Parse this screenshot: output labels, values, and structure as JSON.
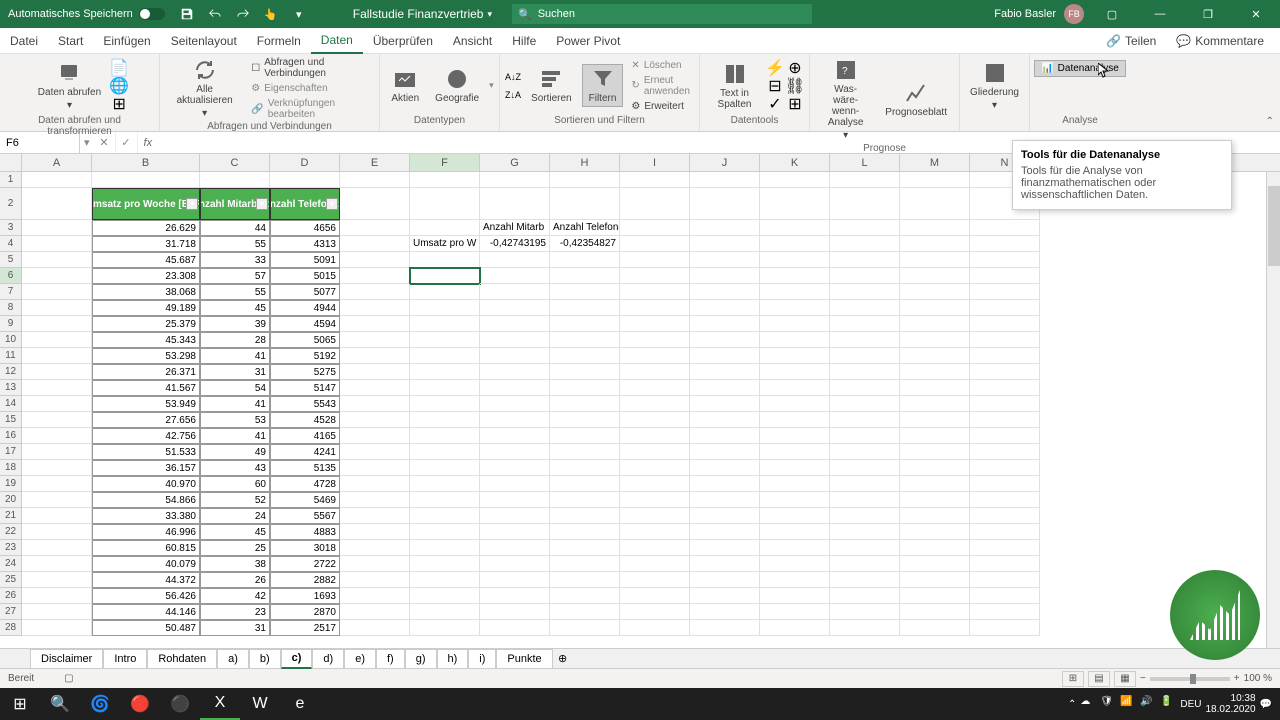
{
  "titlebar": {
    "autosave": "Automatisches Speichern",
    "filename": "Fallstudie Finanzvertrieb",
    "search_placeholder": "Suchen",
    "user": "Fabio Basler",
    "user_initials": "FB"
  },
  "menubar": {
    "items": [
      "Datei",
      "Start",
      "Einfügen",
      "Seitenlayout",
      "Formeln",
      "Daten",
      "Überprüfen",
      "Ansicht",
      "Hilfe",
      "Power Pivot"
    ],
    "active_index": 5,
    "share": "Teilen",
    "comments": "Kommentare"
  },
  "ribbon": {
    "groups": {
      "abrufen": {
        "label": "Daten abrufen und transformieren",
        "daten_abrufen": "Daten abrufen"
      },
      "abfragen": {
        "label": "Abfragen und Verbindungen",
        "alle_aktualisieren": "Alle aktualisieren",
        "abfragen": "Abfragen und Verbindungen",
        "eigenschaften": "Eigenschaften",
        "verknuepfungen": "Verknüpfungen bearbeiten"
      },
      "datentypen": {
        "label": "Datentypen",
        "aktien": "Aktien",
        "geografie": "Geografie"
      },
      "sortieren": {
        "label": "Sortieren und Filtern",
        "sortieren": "Sortieren",
        "filtern": "Filtern",
        "loeschen": "Löschen",
        "erneut": "Erneut anwenden",
        "erweitert": "Erweitert"
      },
      "datentools": {
        "label": "Datentools",
        "text_spalten": "Text in Spalten"
      },
      "prognose": {
        "label": "Prognose",
        "was_waere": "Was-wäre-wenn-Analyse",
        "prognoseblatt": "Prognoseblatt"
      },
      "gliederung": {
        "label": "",
        "gliederung": "Gliederung"
      },
      "analyse": {
        "label": "Analyse",
        "datenanalyse": "Datenanalyse"
      }
    }
  },
  "tooltip": {
    "title": "Tools für die Datenanalyse",
    "body": "Tools für die Analyse von finanzmathematischen oder wissenschaftlichen Daten."
  },
  "formula_bar": {
    "name_box": "F6",
    "formula": ""
  },
  "columns": [
    "A",
    "B",
    "C",
    "D",
    "E",
    "F",
    "G",
    "H",
    "I",
    "J",
    "K",
    "L",
    "M",
    "N"
  ],
  "selected_col": "F",
  "selected_row": 6,
  "table": {
    "headers": {
      "b": "Umsatz pro Woche [EUR]",
      "c": "Anzahl Mitarbeiter",
      "d": "Anzahl Telefonate"
    },
    "rows": [
      {
        "b": "26.629",
        "c": "44",
        "d": "4656"
      },
      {
        "b": "31.718",
        "c": "55",
        "d": "4313"
      },
      {
        "b": "45.687",
        "c": "33",
        "d": "5091"
      },
      {
        "b": "23.308",
        "c": "57",
        "d": "5015"
      },
      {
        "b": "38.068",
        "c": "55",
        "d": "5077"
      },
      {
        "b": "49.189",
        "c": "45",
        "d": "4944"
      },
      {
        "b": "25.379",
        "c": "39",
        "d": "4594"
      },
      {
        "b": "45.343",
        "c": "28",
        "d": "5065"
      },
      {
        "b": "53.298",
        "c": "41",
        "d": "5192"
      },
      {
        "b": "26.371",
        "c": "31",
        "d": "5275"
      },
      {
        "b": "41.567",
        "c": "54",
        "d": "5147"
      },
      {
        "b": "53.949",
        "c": "41",
        "d": "5543"
      },
      {
        "b": "27.656",
        "c": "53",
        "d": "4528"
      },
      {
        "b": "42.756",
        "c": "41",
        "d": "4165"
      },
      {
        "b": "51.533",
        "c": "49",
        "d": "4241"
      },
      {
        "b": "36.157",
        "c": "43",
        "d": "5135"
      },
      {
        "b": "40.970",
        "c": "60",
        "d": "4728"
      },
      {
        "b": "54.866",
        "c": "52",
        "d": "5469"
      },
      {
        "b": "33.380",
        "c": "24",
        "d": "5567"
      },
      {
        "b": "46.996",
        "c": "45",
        "d": "4883"
      },
      {
        "b": "60.815",
        "c": "25",
        "d": "3018"
      },
      {
        "b": "40.079",
        "c": "38",
        "d": "2722"
      },
      {
        "b": "44.372",
        "c": "26",
        "d": "2882"
      },
      {
        "b": "56.426",
        "c": "42",
        "d": "1693"
      },
      {
        "b": "44.146",
        "c": "23",
        "d": "2870"
      },
      {
        "b": "50.487",
        "c": "31",
        "d": "2517"
      }
    ]
  },
  "correlation": {
    "col_g": "Anzahl Mitarb",
    "col_h": "Anzahl Telefonate",
    "row_label": "Umsatz pro W",
    "val_g": "-0,42743195",
    "val_h": "-0,42354827"
  },
  "sheets": {
    "tabs": [
      "Disclaimer",
      "Intro",
      "Rohdaten",
      "a)",
      "b)",
      "c)",
      "d)",
      "e)",
      "f)",
      "g)",
      "h)",
      "i)",
      "Punkte"
    ],
    "active_index": 5
  },
  "statusbar": {
    "ready": "Bereit",
    "zoom": "100 %"
  },
  "taskbar": {
    "lang": "DEU",
    "time": "10:38",
    "date": "18.02.2020"
  }
}
